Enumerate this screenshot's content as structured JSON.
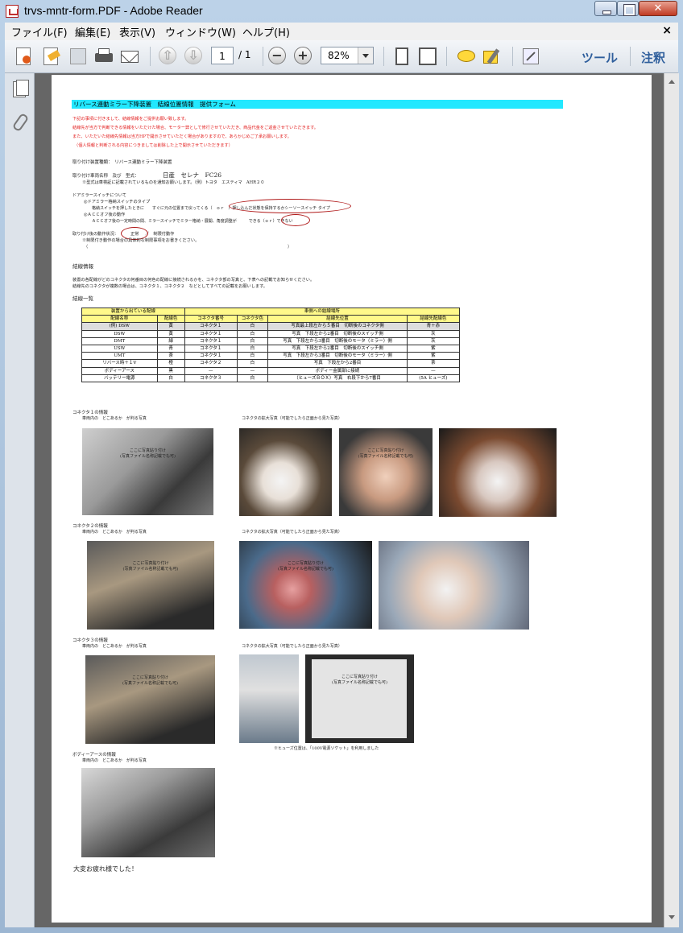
{
  "window": {
    "title": "trvs-mntr-form.PDF - Adobe Reader",
    "close_glyph": "✕"
  },
  "menu": [
    "ファイル(F)",
    "編集(E)",
    "表示(V)",
    "ウィンドウ(W)",
    "ヘルプ(H)"
  ],
  "menu_close": "×",
  "toolbar": {
    "page_current": "1",
    "page_total": "/ 1",
    "zoom": "82%",
    "tools_label": "ツール",
    "comment_label": "注釈",
    "icons": [
      "create-pdf-icon",
      "edit-icon",
      "save-icon",
      "print-icon",
      "email-icon",
      "prev-page-icon",
      "next-page-icon",
      "zoom-out-icon",
      "zoom-in-icon",
      "fit-page-icon",
      "fit-width-icon",
      "comment-icon",
      "highlight-icon",
      "fullscreen-icon"
    ]
  },
  "sidebar": {
    "icons": [
      "pages-icon",
      "attachment-icon"
    ]
  },
  "doc": {
    "title": "リバース連動ミラー下降装置　結線位置情報　提供フォーム",
    "intro": [
      "下記の事項に付きまして、結線情報をご提供お願い致します。",
      "結線先が当方で判断できる情報をいただけた場合、モーター弊として修行させていただき、商品代金をご返金させていただきます。",
      "また、いただいた結線先情報は当方HPで開示させていただく場合がありますので、あらかじめご了承お願いします。",
      "（個人情報と判断される内容につきましては削除した上で開示させていただきます）"
    ],
    "device_type": "取り付け装置種類：　リバース連動ミラー下降装置",
    "vehicle_label": "取り付け車両名称　及び　型式：",
    "vehicle_value": "日産　セレナ　FC26",
    "vehicle_note": "※型式は車検証に記載されているものを通知お願いします。（例）トヨタ　エスティマ　AHR２０",
    "switch_heading": "ドアミラースイッチについて",
    "switch_type": "◎ドアミラー格納スイッチのタイプ",
    "switch_type_desc": "格納スイッチを押したときに　　すぐに元の位置まで戻ってくる（　ｏｒ　）押し込んだ状態を保持するかシーソースイッチ タイプ",
    "acc_label": "◎ＡＣＣオフ後の動作",
    "acc_desc": "ＡＣＣオフ後の一定時間の間、ミラースイッチでミラー格納・展開、角度調整が　　　できる（ｏｒ）できない",
    "post_label": "取り付け後の動作状況：",
    "post_value": "正常",
    "post_mid": "／　制限付動作",
    "post_note": "※制限付き動作の場合の具体的な制限事項をお書きください。",
    "paren_open": "（",
    "paren_close": "）",
    "wiring_heading": "結線情報",
    "wiring_desc1": "装置の各配線がどのコネクタの何番目の何色の配線に接続されるかを、コネクタ部の写真と、下表への記載でお知らせください。",
    "wiring_desc2": "結線先のコネクタが複数の場合は、コネクタ１、コネクタ２　などとしてすべての記載をお願いします。",
    "list_heading": "結線一覧",
    "table": {
      "group_left": "装置から出ている配線",
      "group_right": "車側への結線場所",
      "headers": [
        "配線名称",
        "配線色",
        "コネクタ番号",
        "コネクタ色",
        "結線先位置",
        "結線先配線色"
      ],
      "example": [
        "(例) DSW",
        "黄",
        "コネクタ１",
        "白",
        "写真最上段左から５番目　切断後のコネクタ側",
        "青＋赤"
      ],
      "rows": [
        [
          "DSW",
          "黄",
          "コネクタ１",
          "白",
          "写真　下段左から2番目　切断後のスイッチ側",
          "灰"
        ],
        [
          "DMT",
          "緑",
          "コネクタ１",
          "白",
          "写真　下段左から3番目　切断後のモータ（ミラー）側",
          "灰"
        ],
        [
          "USW",
          "青",
          "コネクタ１",
          "白",
          "写真　下段左から2番目　切断後のスイッチ側",
          "紫"
        ],
        [
          "UMT",
          "茶",
          "コネクタ１",
          "白",
          "写真　下段左から3番目　切断後のモータ（ミラー）側",
          "紫"
        ],
        [
          "リバース時＋１V",
          "橙",
          "コネクタ２",
          "白",
          "写真　下段左から2番目",
          "茶"
        ],
        [
          "ボディーアース",
          "黒",
          "—",
          "—",
          "ボディー金属部に接続",
          "—"
        ],
        [
          "バッテリー電源",
          "白",
          "コネクタ３",
          "白",
          "（ヒューズＢＯＸ）写真　右段下から7番目",
          "(5A ヒューズ)"
        ]
      ]
    },
    "sections": [
      {
        "title": "コネクタ１の情報",
        "left_cap": "車両内の　どこあるか　が判る写真",
        "right_cap": "コネクタの拡大写真（可能でしたら正面から見た写真）"
      },
      {
        "title": "コネクタ２の情報",
        "left_cap": "車両内の　どこあるか　が判る写真",
        "right_cap": "コネクタの拡大写真（可能でしたら正面から見た写真）"
      },
      {
        "title": "コネクタ３の情報",
        "left_cap": "車両内の　どこあるか　が判る写真",
        "right_cap": "コネクタの拡大写真（可能でしたら正面から見た写真）"
      },
      {
        "title": "ボディーアースの情報",
        "left_cap": "車両内の　どこあるか　が判る写真"
      }
    ],
    "photo_placeholder": "ここに写真貼り付け",
    "photo_placeholder2": "(写真ファイル名称記載でも可)",
    "fuse_note": "※ヒューズ位置は、「100V電源ソケット」を利用しました",
    "closing": "大変お疲れ様でした！"
  }
}
